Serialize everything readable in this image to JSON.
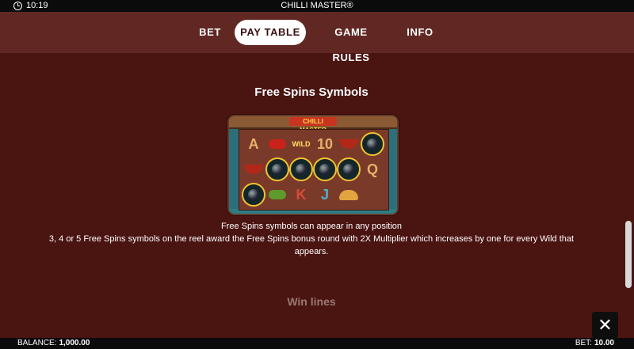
{
  "status": {
    "time": "10:19",
    "app_title": "CHILLI MASTER®"
  },
  "nav": {
    "tabs": [
      {
        "label": "BET",
        "active": false
      },
      {
        "label": "PAY TABLE",
        "active": true
      },
      {
        "label": "GAME RULES",
        "active": false
      },
      {
        "label": "INFO",
        "active": false
      }
    ]
  },
  "section": {
    "title": "Free Spins Symbols",
    "image_logo_text": "CHILLI MASTER",
    "grid": [
      [
        "A",
        "pepper",
        "WILD",
        "10",
        "bowl",
        "freespin"
      ],
      [
        "bowl",
        "freespin",
        "freespin",
        "freespin",
        "freespin",
        "Q"
      ],
      [
        "freespin",
        "pepper-green",
        "K",
        "J",
        "taco",
        ""
      ]
    ],
    "desc_line1": "Free Spins symbols can appear in any position",
    "desc_line2": "3, 4 or 5 Free Spins symbols on the reel award the Free Spins bonus round with 2X Multiplier which increases by one for every Wild that",
    "desc_line3": "appears.",
    "next_title": "Win lines"
  },
  "footer": {
    "balance_label": "BALANCE:",
    "balance_value": "1,000.00",
    "bet_label": "BET:",
    "bet_value": "10.00"
  },
  "icons": {
    "clock": "clock-icon",
    "close": "close-icon"
  },
  "colors": {
    "background": "#4a1411",
    "nav": "#612823",
    "accent": "#f2c230"
  }
}
